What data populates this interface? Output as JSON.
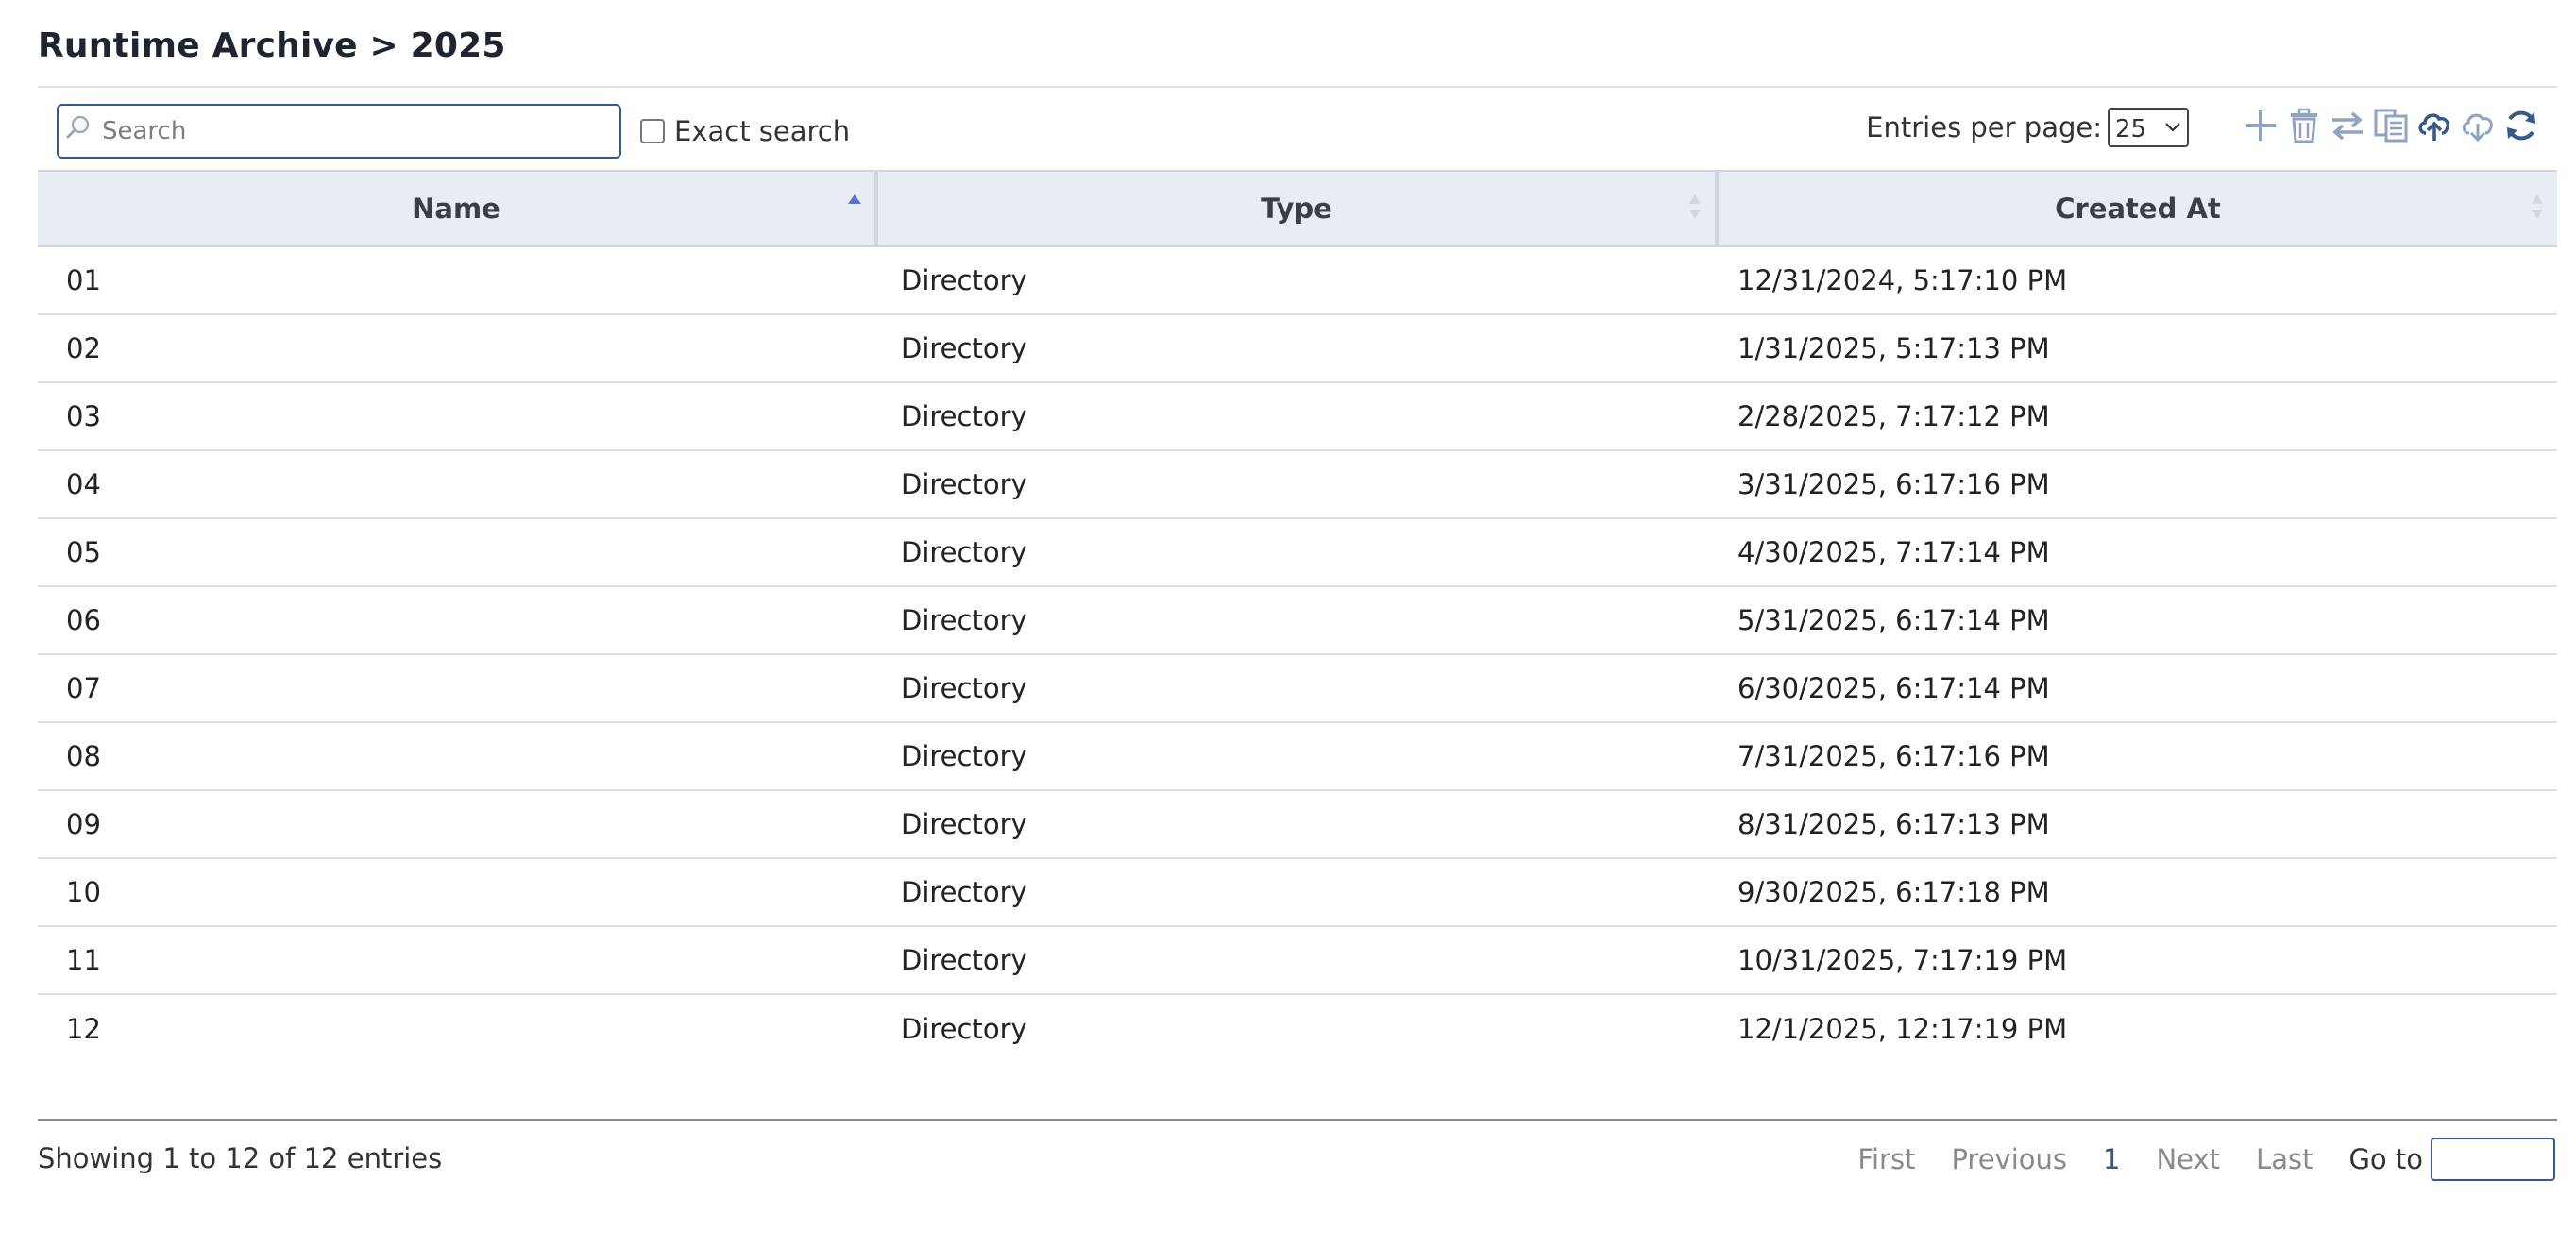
{
  "page": {
    "title": "Runtime Archive > 2025"
  },
  "toolbar": {
    "search_placeholder": "Search",
    "exact_search_label": "Exact search",
    "entries_per_page_label": "Entries per page:",
    "entries_per_page_value": "25",
    "icons": [
      "add-icon",
      "delete-icon",
      "move-icon",
      "copy-icon",
      "upload-icon",
      "download-icon",
      "refresh-icon"
    ],
    "accent_color": "#34598a"
  },
  "table": {
    "columns": [
      "Name",
      "Type",
      "Created At"
    ],
    "sorted_column": "Name",
    "sort_direction": "ascending",
    "rows": [
      {
        "name": "01",
        "type": "Directory",
        "created_at": "12/31/2024, 5:17:10 PM"
      },
      {
        "name": "02",
        "type": "Directory",
        "created_at": "1/31/2025, 5:17:13 PM"
      },
      {
        "name": "03",
        "type": "Directory",
        "created_at": "2/28/2025, 7:17:12 PM"
      },
      {
        "name": "04",
        "type": "Directory",
        "created_at": "3/31/2025, 6:17:16 PM"
      },
      {
        "name": "05",
        "type": "Directory",
        "created_at": "4/30/2025, 7:17:14 PM"
      },
      {
        "name": "06",
        "type": "Directory",
        "created_at": "5/31/2025, 6:17:14 PM"
      },
      {
        "name": "07",
        "type": "Directory",
        "created_at": "6/30/2025, 6:17:14 PM"
      },
      {
        "name": "08",
        "type": "Directory",
        "created_at": "7/31/2025, 6:17:16 PM"
      },
      {
        "name": "09",
        "type": "Directory",
        "created_at": "8/31/2025, 6:17:13 PM"
      },
      {
        "name": "10",
        "type": "Directory",
        "created_at": "9/30/2025, 6:17:18 PM"
      },
      {
        "name": "11",
        "type": "Directory",
        "created_at": "10/31/2025, 7:17:19 PM"
      },
      {
        "name": "12",
        "type": "Directory",
        "created_at": "12/1/2025, 12:17:19 PM"
      }
    ]
  },
  "footer": {
    "info": "Showing 1 to 12 of 12 entries",
    "first": "First",
    "previous": "Previous",
    "current_page": "1",
    "next": "Next",
    "last": "Last",
    "goto_label": "Go to"
  }
}
